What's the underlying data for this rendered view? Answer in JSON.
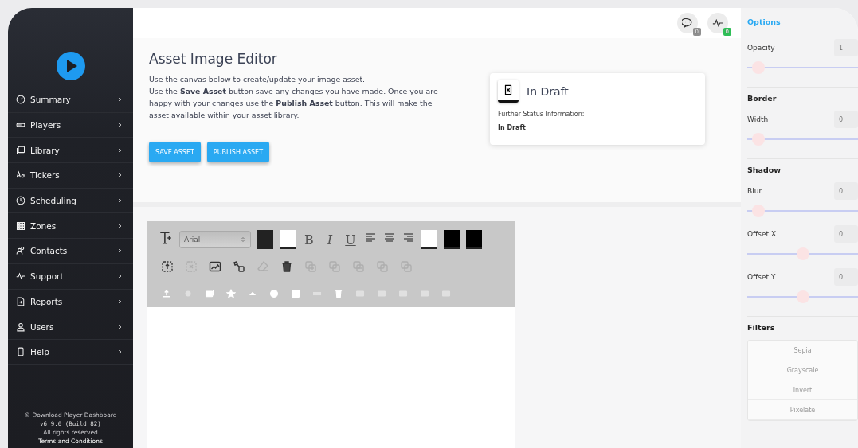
{
  "sidebar": {
    "items": [
      {
        "label": "Summary",
        "selected": false
      },
      {
        "label": "Players",
        "selected": false
      },
      {
        "label": "Library",
        "selected": false
      },
      {
        "label": "Tickers",
        "selected": false
      },
      {
        "label": "Scheduling",
        "selected": false
      },
      {
        "label": "Zones",
        "selected": false
      },
      {
        "label": "Contacts",
        "selected": false
      },
      {
        "label": "Support",
        "selected": false
      },
      {
        "label": "Reports",
        "selected": false
      },
      {
        "label": "Users",
        "selected": false
      },
      {
        "label": "Help",
        "selected": false
      }
    ],
    "footer": {
      "copyright": "© Download Player Dashboard",
      "version": "v6.9.0 (Build 82)",
      "rights": "All rights reserved",
      "terms": "Terms and Conditions"
    }
  },
  "topbar": {
    "badges": [
      {
        "count": "0",
        "color": "#8f8f8f"
      },
      {
        "count": "0",
        "color": "#2fbf57"
      }
    ]
  },
  "header": {
    "title": "Asset Image Editor",
    "paragraphs": [
      "Use the canvas below to create/update your image asset.",
      "Use the **Save Asset** button save any changes you have made. Once you are happy with your changes use the **Publish Asset** button. This will make the asset available within your asset library."
    ],
    "buttons": [
      "SAVE ASSET",
      "PUBLISH ASSET"
    ]
  },
  "status_card": {
    "title": "In Draft",
    "label": "Further Status Information:",
    "value": "In Draft"
  },
  "toolbar": {
    "font": "Arial",
    "fill_swatches": [
      {
        "color": "#222222"
      },
      {
        "color": "#ffffff"
      }
    ],
    "styles": [
      "B",
      "I",
      "U"
    ],
    "stroke_swatches": [
      {
        "color": "#ffffff"
      },
      {
        "color": "#000000"
      },
      {
        "color": "#000000"
      }
    ],
    "tools": [
      {
        "disabled": false
      },
      {
        "disabled": true
      },
      {
        "disabled": false
      },
      {
        "disabled": false
      },
      {
        "disabled": true
      },
      {
        "disabled": false
      },
      {
        "disabled": true
      },
      {
        "disabled": true
      },
      {
        "disabled": true
      },
      {
        "disabled": true
      },
      {
        "disabled": true
      }
    ],
    "shapes": [
      {
        "disabled": false
      },
      {
        "disabled": true
      },
      {
        "disabled": false
      },
      {
        "disabled": false
      },
      {
        "disabled": false
      },
      {
        "disabled": false
      },
      {
        "disabled": false
      },
      {
        "disabled": true
      },
      {
        "disabled": false
      },
      {
        "disabled": true
      },
      {
        "disabled": true
      },
      {
        "disabled": true
      },
      {
        "disabled": true
      },
      {
        "disabled": true
      }
    ]
  },
  "options": {
    "title": "Options",
    "rows": [
      {
        "kind": "slider",
        "label": "Opacity",
        "value": "1",
        "level": 0.05
      },
      {
        "kind": "heading",
        "label": "Border"
      },
      {
        "kind": "slider",
        "label": "Width",
        "value": "0",
        "level": 0.05
      },
      {
        "kind": "heading",
        "label": "Shadow"
      },
      {
        "kind": "slider",
        "label": "Blur",
        "value": "0",
        "level": 0.05
      },
      {
        "kind": "slider",
        "label": "Offset X",
        "value": "0",
        "level": 0.5
      },
      {
        "kind": "slider",
        "label": "Offset Y",
        "value": "0",
        "level": 0.5
      },
      {
        "kind": "heading",
        "label": "Filters"
      },
      {
        "kind": "filters",
        "filters": [
          {
            "label": "Sepia",
            "disabled": true
          },
          {
            "label": "Grayscale",
            "disabled": true
          },
          {
            "label": "Invert",
            "disabled": true
          },
          {
            "label": "Pixelate",
            "disabled": true
          }
        ]
      }
    ]
  }
}
